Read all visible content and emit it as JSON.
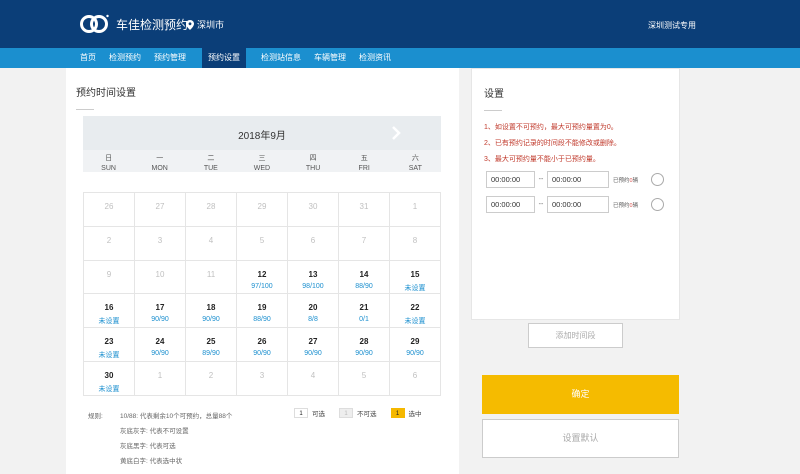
{
  "header": {
    "brand": "车佳检测预约",
    "city": "深圳市",
    "account": "深圳测试专用",
    "colors": {
      "bar": "#0b3e78",
      "nav": "#1b8fcf",
      "accent": "#f5bb00"
    }
  },
  "nav": {
    "items": [
      {
        "label": "首页"
      },
      {
        "label": "检测预约"
      },
      {
        "label": "预约管理"
      },
      {
        "label": "预约设置",
        "active": true
      },
      {
        "label": "检测站信息"
      },
      {
        "label": "车辆管理"
      },
      {
        "label": "检测资讯"
      }
    ]
  },
  "calendar": {
    "title": "预约时间设置",
    "month": "2018年9月",
    "next_icon": "chevron-right-icon",
    "weekdays": [
      {
        "cn": "日",
        "en": "SUN"
      },
      {
        "cn": "一",
        "en": "MON"
      },
      {
        "cn": "二",
        "en": "TUE"
      },
      {
        "cn": "三",
        "en": "WED"
      },
      {
        "cn": "四",
        "en": "THU"
      },
      {
        "cn": "五",
        "en": "FRI"
      },
      {
        "cn": "六",
        "en": "SAT"
      }
    ],
    "days": [
      {
        "num": "26",
        "info": "",
        "dim": true
      },
      {
        "num": "27",
        "info": "",
        "dim": true
      },
      {
        "num": "28",
        "info": "",
        "dim": true
      },
      {
        "num": "29",
        "info": "",
        "dim": true
      },
      {
        "num": "30",
        "info": "",
        "dim": true
      },
      {
        "num": "31",
        "info": "",
        "dim": true
      },
      {
        "num": "1",
        "info": "",
        "dim": true
      },
      {
        "num": "2",
        "info": "",
        "dim": true
      },
      {
        "num": "3",
        "info": "",
        "dim": true
      },
      {
        "num": "4",
        "info": "",
        "dim": true
      },
      {
        "num": "5",
        "info": "",
        "dim": true
      },
      {
        "num": "6",
        "info": "",
        "dim": true
      },
      {
        "num": "7",
        "info": "",
        "dim": true
      },
      {
        "num": "8",
        "info": "",
        "dim": true
      },
      {
        "num": "9",
        "info": "",
        "dim": true
      },
      {
        "num": "10",
        "info": "",
        "dim": true
      },
      {
        "num": "11",
        "info": "",
        "dim": true
      },
      {
        "num": "12",
        "info": "97/100",
        "dim": false
      },
      {
        "num": "13",
        "info": "98/100",
        "dim": false
      },
      {
        "num": "14",
        "info": "88/90",
        "dim": false
      },
      {
        "num": "15",
        "info": "未设置",
        "dim": false
      },
      {
        "num": "16",
        "info": "未设置",
        "dim": false
      },
      {
        "num": "17",
        "info": "90/90",
        "dim": false
      },
      {
        "num": "18",
        "info": "90/90",
        "dim": false
      },
      {
        "num": "19",
        "info": "88/90",
        "dim": false
      },
      {
        "num": "20",
        "info": "8/8",
        "dim": false
      },
      {
        "num": "21",
        "info": "0/1",
        "dim": false
      },
      {
        "num": "22",
        "info": "未设置",
        "dim": false
      },
      {
        "num": "23",
        "info": "未设置",
        "dim": false
      },
      {
        "num": "24",
        "info": "90/90",
        "dim": false
      },
      {
        "num": "25",
        "info": "89/90",
        "dim": false
      },
      {
        "num": "26",
        "info": "90/90",
        "dim": false
      },
      {
        "num": "27",
        "info": "90/90",
        "dim": false
      },
      {
        "num": "28",
        "info": "90/90",
        "dim": false
      },
      {
        "num": "29",
        "info": "90/90",
        "dim": false
      },
      {
        "num": "30",
        "info": "未设置",
        "dim": false
      },
      {
        "num": "1",
        "info": "",
        "dim": true
      },
      {
        "num": "2",
        "info": "",
        "dim": true
      },
      {
        "num": "3",
        "info": "",
        "dim": true
      },
      {
        "num": "4",
        "info": "",
        "dim": true
      },
      {
        "num": "5",
        "info": "",
        "dim": true
      },
      {
        "num": "6",
        "info": "",
        "dim": true
      }
    ]
  },
  "legend": {
    "rule_label": "规则:",
    "lines": [
      "10/88: 代表剩余10个可预约，总量88个",
      "灰底灰字: 代表不可设置",
      "灰底黑字: 代表可选",
      "黄底白字: 代表选中状"
    ],
    "chips": [
      {
        "chip": "1",
        "text": "可选"
      },
      {
        "chip": "1",
        "text": "不可选"
      },
      {
        "chip": "1",
        "text": "选中"
      }
    ]
  },
  "settings": {
    "title": "设置",
    "notes": [
      "1、如设置不可预约，最大可预约量置为0。",
      "2、已有预约记录的时间段不能修改或删除。",
      "3、最大可预约量不能小于已预约量。"
    ],
    "slots": [
      {
        "start": "00:00:00",
        "end": "00:00:00",
        "booked_prefix": "已预约",
        "booked_count": "0",
        "booked_suffix": "辆"
      },
      {
        "start": "00:00:00",
        "end": "00:00:00",
        "booked_prefix": "已预约",
        "booked_count": "0",
        "booked_suffix": "辆"
      }
    ],
    "separator": "--",
    "add_slot": "添加时间段",
    "confirm": "确定",
    "set_default": "设置默认"
  }
}
